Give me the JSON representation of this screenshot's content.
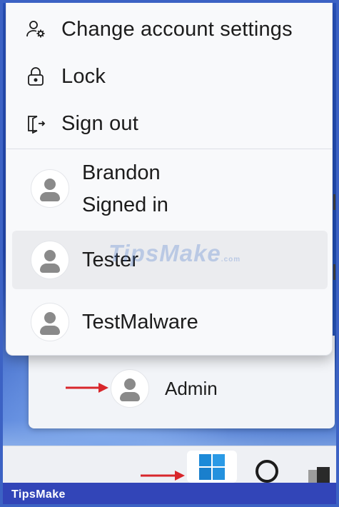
{
  "menu": {
    "items": [
      {
        "label": "Change account settings",
        "icon": "person-gear-icon"
      },
      {
        "label": "Lock",
        "icon": "lock-icon"
      },
      {
        "label": "Sign out",
        "icon": "sign-out-icon"
      }
    ],
    "users": [
      {
        "name": "Brandon",
        "status": "Signed in",
        "icon": "user-avatar-icon"
      },
      {
        "name": "Tester",
        "icon": "user-avatar-icon"
      },
      {
        "name": "TestMalware",
        "icon": "user-avatar-icon"
      }
    ]
  },
  "start_panel": {
    "current_user": "Admin"
  },
  "watermark": {
    "text": "TipsMake",
    "suffix": ".com"
  },
  "footer": {
    "brand": "TipsMake"
  },
  "colors": {
    "menu_background": "#f8f9fb",
    "hover_row": "#ebecef",
    "annotation_arrow": "#d8262b",
    "start_logo": "#1d8ad8",
    "footer_bar": "#3245b8"
  }
}
